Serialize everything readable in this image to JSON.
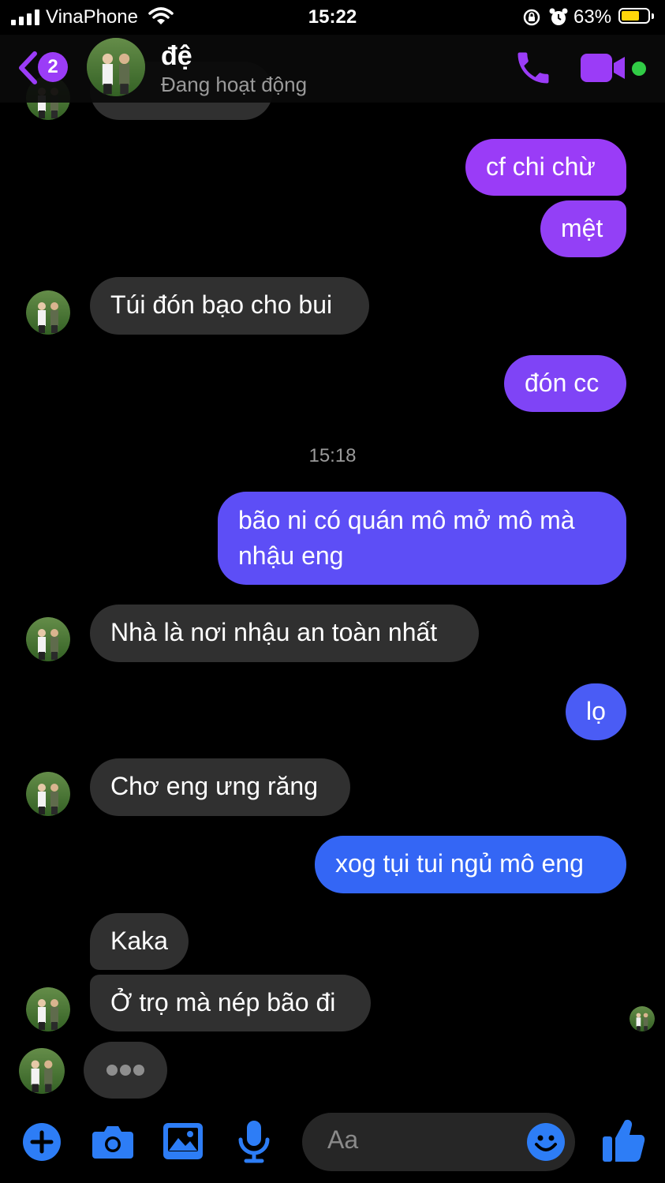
{
  "status_bar": {
    "carrier": "VinaPhone",
    "time": "15:22",
    "battery": "63%",
    "battery_level": 0.63
  },
  "header": {
    "unread_badge": "2",
    "contact_name": "đệ",
    "contact_status": "Đang hoạt động"
  },
  "colors": {
    "accent": "#9b3cf7",
    "bubble_in": "#303030",
    "bubble_out_top": "#8f3cf6",
    "bubble_out_bottom": "#2d6ef5",
    "online": "#31cc46"
  },
  "messages": {
    "m1": "cf chi chừ",
    "m2": "mệt",
    "m3": "Túi đón bạo cho bui",
    "m4": "đón cc",
    "timestamp": "15:18",
    "m5_line1": "bão ni có quán mô mở mô mà",
    "m5_line2": "nhậu eng",
    "m6": "Nhà là nơi nhậu an toàn nhất",
    "m7": "lọ",
    "m8": "Chơ eng ưng răng",
    "m9": "xog tụi tui ngủ mô eng",
    "m10": "Kaka",
    "m11": "Ở trọ mà nép bão đi"
  },
  "composer": {
    "placeholder": "Aa"
  },
  "icons": [
    "plus-icon",
    "camera-icon",
    "image-icon",
    "microphone-icon",
    "emoji-icon",
    "thumbs-up-icon",
    "phone-icon",
    "video-icon",
    "back-chevron-icon",
    "typing-indicator"
  ]
}
